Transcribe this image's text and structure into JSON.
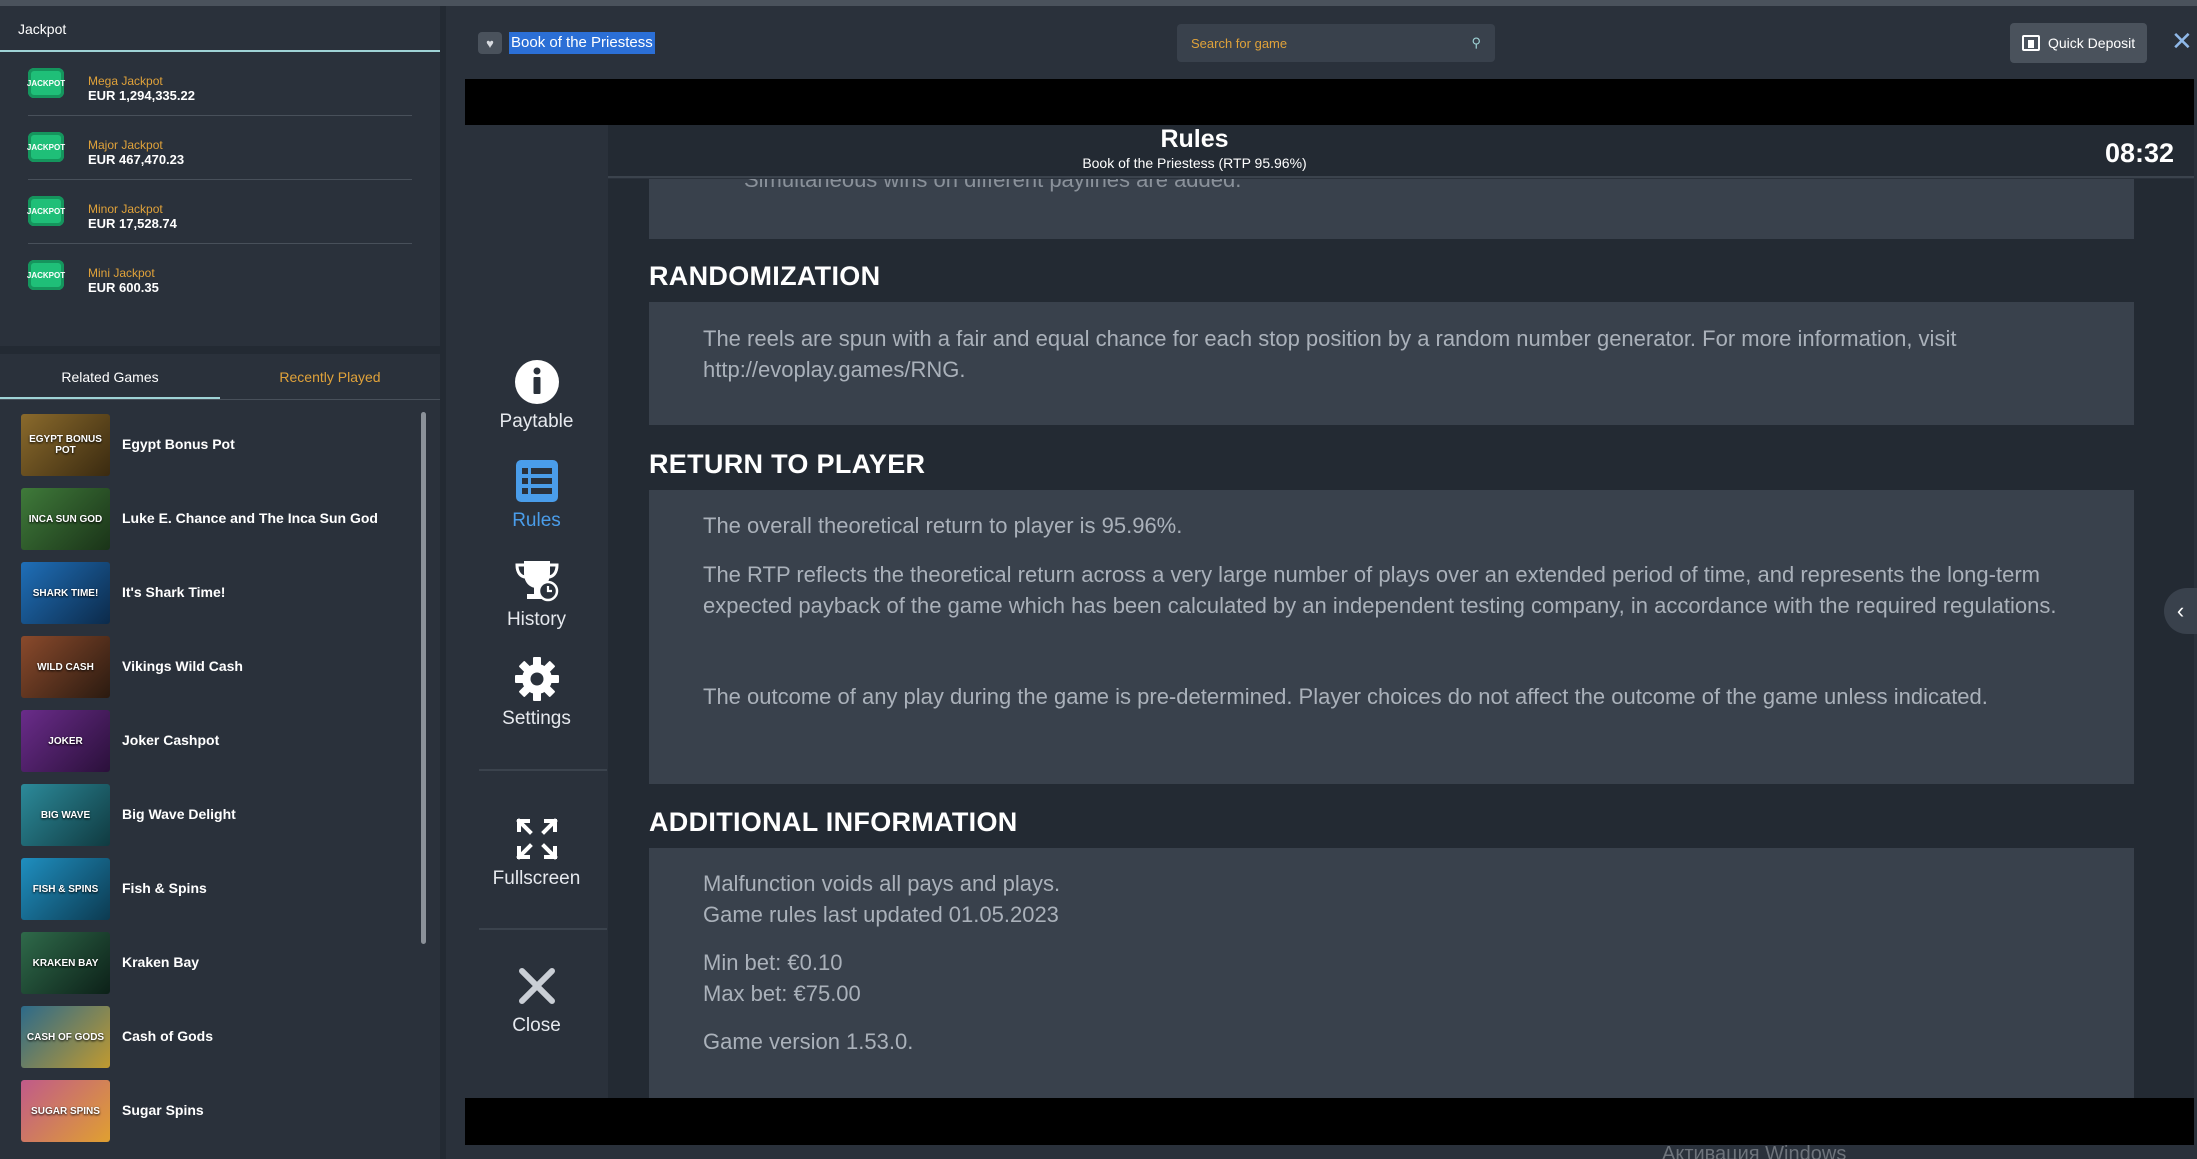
{
  "jackpot": {
    "header": "Jackpot",
    "icon_label": "JACKPOT",
    "items": [
      {
        "name": "Mega Jackpot",
        "value": "EUR 1,294,335.22"
      },
      {
        "name": "Major Jackpot",
        "value": "EUR 467,470.23"
      },
      {
        "name": "Minor Jackpot",
        "value": "EUR 17,528.74"
      },
      {
        "name": "Mini Jackpot",
        "value": "EUR 600.35"
      }
    ]
  },
  "games_tabs": {
    "related": "Related Games",
    "recent": "Recently Played"
  },
  "games": [
    {
      "title": "Egypt Bonus Pot",
      "thumb": "EGYPT BONUS POT",
      "color": "#8a6a2c"
    },
    {
      "title": "Luke E. Chance and The Inca Sun God",
      "thumb": "INCA SUN GOD",
      "color": "#3f7a3a"
    },
    {
      "title": "It's Shark Time!",
      "thumb": "SHARK TIME!",
      "color": "#1f6fb8"
    },
    {
      "title": "Vikings Wild Cash",
      "thumb": "WILD CASH",
      "color": "#8a4a2c"
    },
    {
      "title": "Joker Cashpot",
      "thumb": "JOKER",
      "color": "#6a2c8a"
    },
    {
      "title": "Big Wave Delight",
      "thumb": "BIG WAVE",
      "color": "#2c8a9a"
    },
    {
      "title": "Fish & Spins",
      "thumb": "FISH & SPINS",
      "color": "#1f8fc0"
    },
    {
      "title": "Kraken Bay",
      "thumb": "KRAKEN BAY",
      "color": "#1f4a3a"
    },
    {
      "title": "Cash of Gods",
      "thumb": "CASH OF GODS",
      "color": "#2c6a8a"
    },
    {
      "title": "Sugar Spins",
      "thumb": "SUGAR SPINS",
      "color": "#c05a8a"
    }
  ],
  "topbar": {
    "game_title": "Book of the Priestess",
    "search_placeholder": "Search for game",
    "quick_deposit": "Quick Deposit"
  },
  "rules_panel": {
    "title": "Rules",
    "subtitle": "Book of the Priestess (RTP 95.96%)",
    "clock": "08:32",
    "cut_text": "Simultaneous wins on different paylines are added.",
    "sidebar": {
      "paytable": "Paytable",
      "rules": "Rules",
      "history": "History",
      "settings": "Settings",
      "fullscreen": "Fullscreen",
      "close": "Close"
    },
    "sections": {
      "randomization": {
        "title": "RANDOMIZATION",
        "text": "The reels are spun with a fair and equal chance for each stop position by a random number generator. For more information, visit http://evoplay.games/RNG."
      },
      "rtp": {
        "title": "RETURN TO PLAYER",
        "p1": "The overall theoretical return to player is 95.96%.",
        "p2": "The RTP reflects the theoretical return across a very large number of plays over an extended period of time, and represents the long-term expected payback of the game which has been calculated by an independent testing company, in accordance with the required regulations.",
        "p3": "The outcome of any play during the game is pre-determined. Player choices do not affect the outcome of the game unless indicated."
      },
      "additional": {
        "title": "ADDITIONAL INFORMATION",
        "l1": "Malfunction voids all pays and plays.",
        "l2": "Game rules last updated 01.05.2023",
        "l3": "Min bet: €0.10",
        "l4": "Max bet: €75.00",
        "l5": "Game version 1.53.0."
      }
    }
  },
  "watermark": "Активация Windows"
}
